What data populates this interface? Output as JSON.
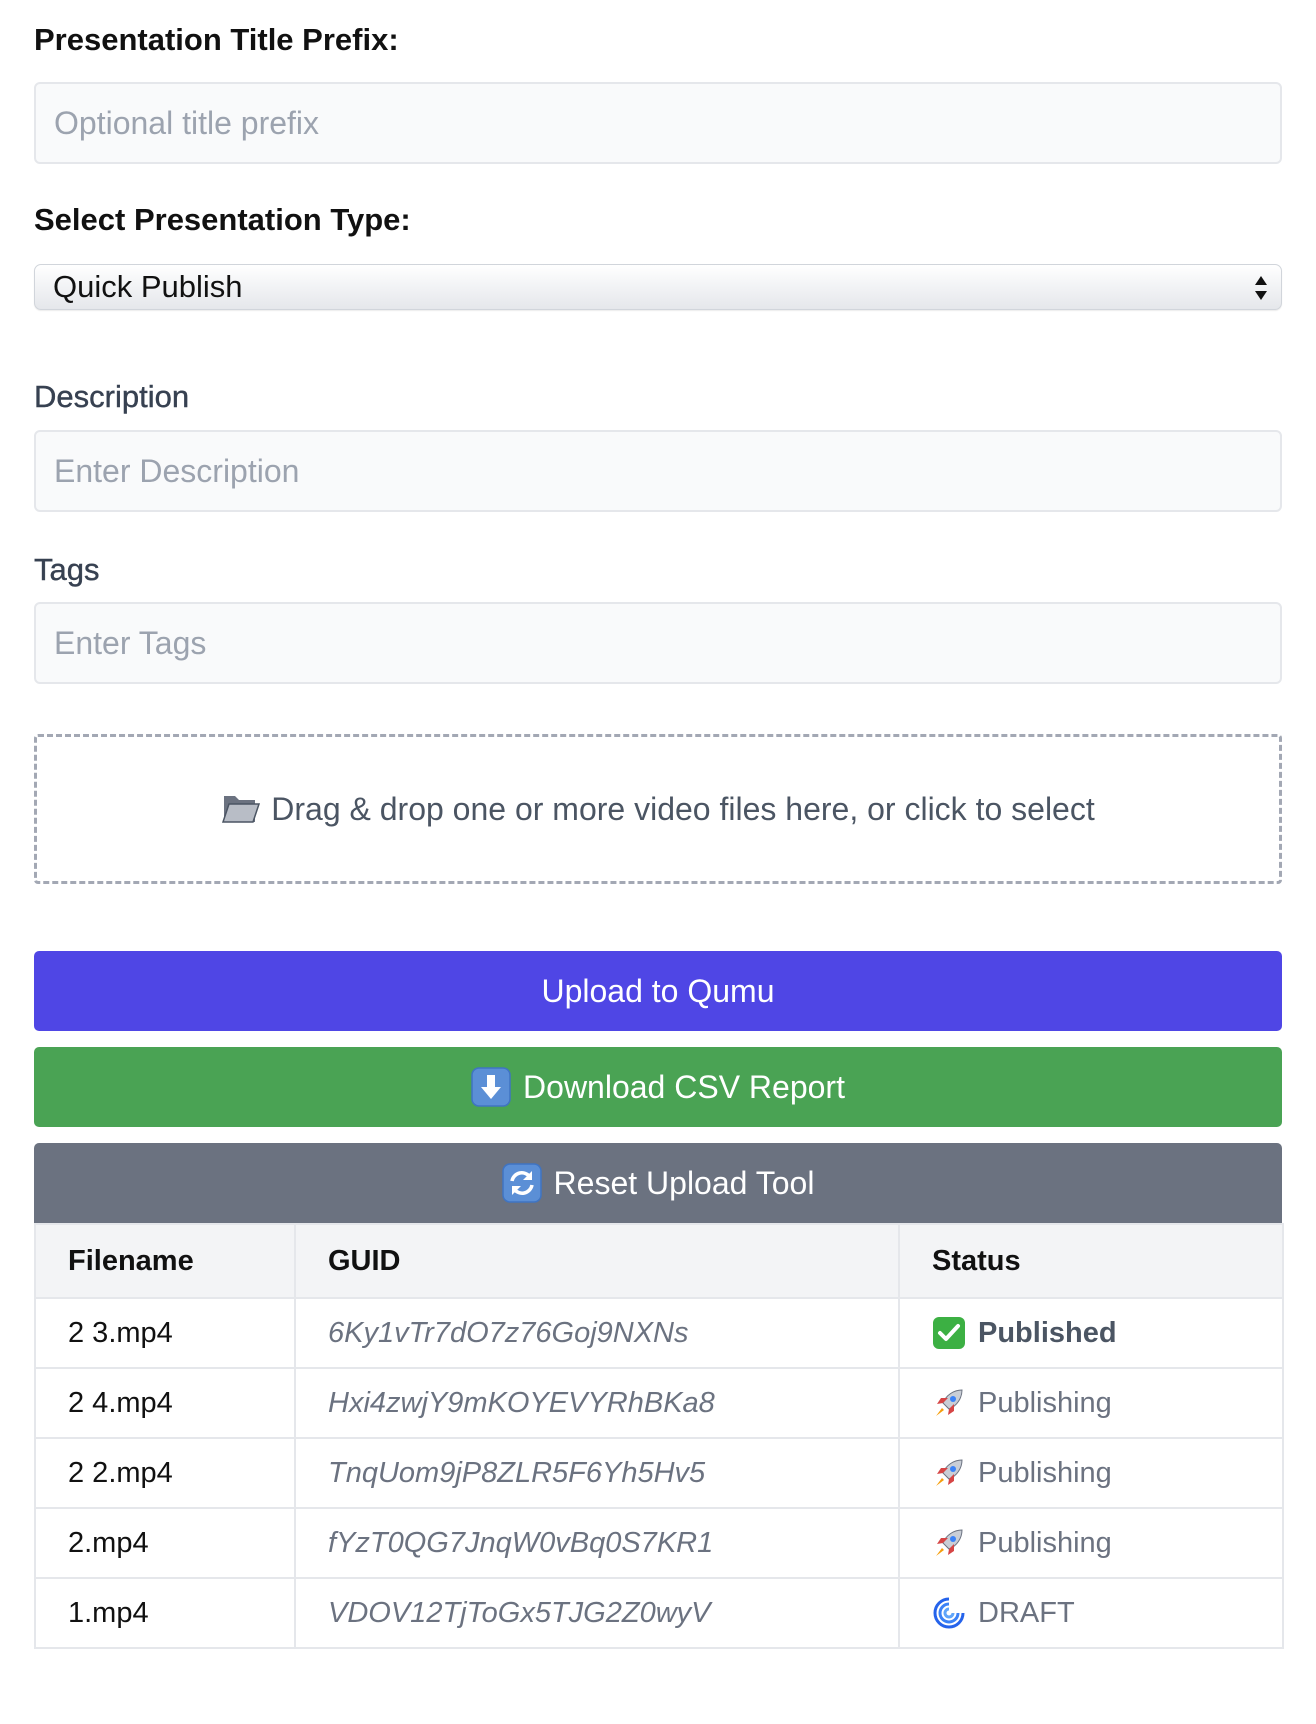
{
  "form": {
    "title_prefix_label": "Presentation Title Prefix:",
    "title_prefix_placeholder": "Optional title prefix",
    "title_prefix_value": "",
    "type_label": "Select Presentation Type:",
    "type_selected": "Quick Publish",
    "description_label": "Description",
    "description_placeholder": "Enter Description",
    "description_value": "",
    "tags_label": "Tags",
    "tags_placeholder": "Enter Tags",
    "tags_value": ""
  },
  "dropzone": {
    "icon": "open-folder-icon",
    "text": "Drag & drop one or more video files here, or click to select"
  },
  "buttons": {
    "upload_label": "Upload to Qumu",
    "download_icon": "down-arrow-icon",
    "download_label": "Download CSV Report",
    "reset_icon": "refresh-icon",
    "reset_label": "Reset Upload Tool"
  },
  "table": {
    "headers": [
      "Filename",
      "GUID",
      "Status"
    ],
    "rows": [
      {
        "filename": "2 3.mp4",
        "guid": "6Ky1vTr7dO7z76Goj9NXNs",
        "status": "Published",
        "status_icon": "check-mark-icon"
      },
      {
        "filename": "2 4.mp4",
        "guid": "Hxi4zwjY9mKOYEVYRhBKa8",
        "status": "Publishing",
        "status_icon": "rocket-icon"
      },
      {
        "filename": "2 2.mp4",
        "guid": "TnqUom9jP8ZLR5F6Yh5Hv5",
        "status": "Publishing",
        "status_icon": "rocket-icon"
      },
      {
        "filename": "2.mp4",
        "guid": "fYzT0QG7JnqW0vBq0S7KR1",
        "status": "Publishing",
        "status_icon": "rocket-icon"
      },
      {
        "filename": "1.mp4",
        "guid": "VDOV12TjToGx5TJG2Z0wyV",
        "status": "DRAFT",
        "status_icon": "cyclone-icon"
      }
    ]
  },
  "colors": {
    "upload_button": "#4f46e5",
    "download_button": "#4aa354",
    "reset_button": "#6b7280",
    "input_background": "#f9fafb",
    "table_header_background": "#f3f4f6"
  }
}
